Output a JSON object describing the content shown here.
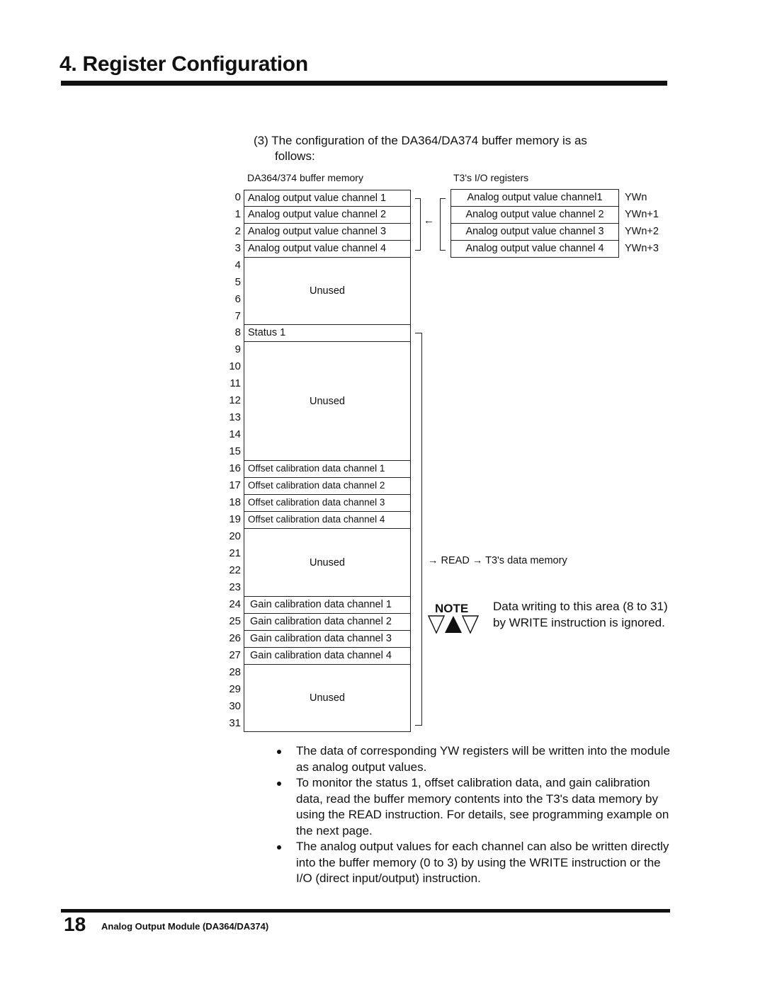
{
  "header": {
    "title": "4.  Register Configuration"
  },
  "intro": {
    "line1": "(3) The configuration of the DA364/DA374 buffer memory is as",
    "line2": "follows:"
  },
  "diagram": {
    "left_caption": "DA364/374 buffer memory",
    "right_caption": "T3's I/O registers",
    "indices": [
      "0",
      "1",
      "2",
      "3",
      "4",
      "5",
      "6",
      "7",
      "8",
      "9",
      "10",
      "11",
      "12",
      "13",
      "14",
      "15",
      "16",
      "17",
      "18",
      "19",
      "20",
      "21",
      "22",
      "23",
      "24",
      "25",
      "26",
      "27",
      "28",
      "29",
      "30",
      "31"
    ],
    "buffer_cells": [
      {
        "label": "Analog output value channel 1"
      },
      {
        "label": "Analog output value channel 2"
      },
      {
        "label": "Analog output value channel 3"
      },
      {
        "label": "Analog output value channel 4"
      },
      {
        "label": "Unused"
      },
      {
        "label": "Status 1"
      },
      {
        "label": "Unused"
      },
      {
        "label": "Offset calibration data channel 1"
      },
      {
        "label": "Offset calibration data channel 2"
      },
      {
        "label": "Offset calibration data channel 3"
      },
      {
        "label": "Offset calibration data channel 4"
      },
      {
        "label": "Unused"
      },
      {
        "label": "Gain calibration data channel 1"
      },
      {
        "label": "Gain calibration data channel 2"
      },
      {
        "label": "Gain calibration data channel 3"
      },
      {
        "label": "Gain calibration data channel 4"
      },
      {
        "label": "Unused"
      }
    ],
    "io_registers": [
      {
        "label": "Analog output value channel1",
        "register": "YWn"
      },
      {
        "label": "Analog output value channel 2",
        "register": "YWn+1"
      },
      {
        "label": "Analog output value channel 3",
        "register": "YWn+2"
      },
      {
        "label": "Analog output value channel 4",
        "register": "YWn+3"
      }
    ],
    "arrow_left": "←",
    "read_note": "→ READ → T3's data memory"
  },
  "note": {
    "label": "NOTE",
    "text": "Data writing to this area (8 to 31) by WRITE instruction is ignored."
  },
  "bullets": [
    "The data of corresponding YW registers will be  written into the module as analog output values.",
    "To monitor the status 1, offset calibration data, and gain calibration data, read the buffer memory contents into the T3's data memory by using the READ instruction. For details, see programming example on the next page.",
    "The analog output values for each channel can also be written directly into the buffer memory (0 to 3) by using the WRITE instruction or the I/O (direct input/output) instruction."
  ],
  "footer": {
    "page_number": "18",
    "title": "Analog Output Module (DA364/DA374)"
  }
}
